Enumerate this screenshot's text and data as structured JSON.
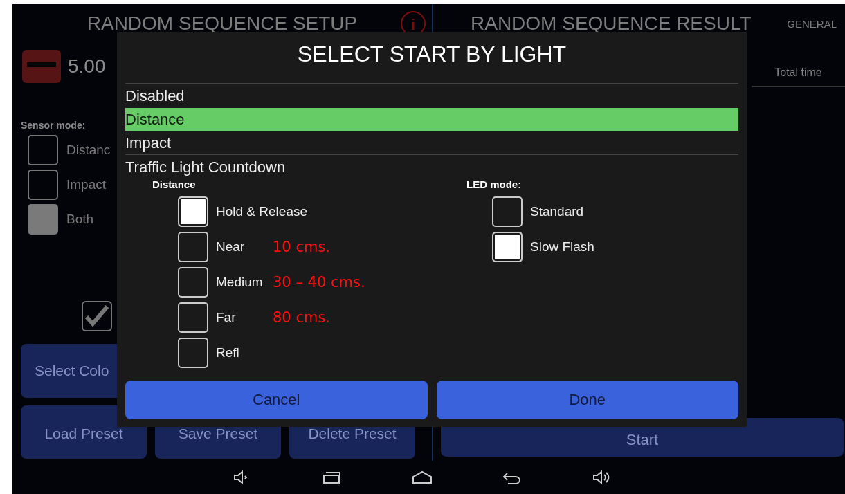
{
  "setup_panel": {
    "title": "RANDOM SEQUENCE SETUP",
    "duration": "5.00",
    "sensor_mode": {
      "label": "Sensor mode:",
      "options": [
        {
          "label": "Distanc",
          "checked": false
        },
        {
          "label": "Impact",
          "checked": false
        },
        {
          "label": "Both",
          "checked": true
        }
      ]
    },
    "enable_checkbox": {
      "checked": true
    },
    "select_color_button": "Select Colo",
    "preset_buttons": [
      "Load Preset",
      "Save Preset",
      "Delete Preset"
    ]
  },
  "result_panel": {
    "title": "RANDOM SEQUENCE RESULT",
    "tab": "GENERAL",
    "column_header": "Total time",
    "start_button": "Start"
  },
  "dialog": {
    "title": "SELECT START BY LIGHT",
    "options": [
      {
        "label": "Disabled",
        "selected": false
      },
      {
        "label": "Distance",
        "selected": true
      },
      {
        "label": "Impact",
        "selected": false
      },
      {
        "label": "Traffic Light Countdown",
        "selected": false
      }
    ],
    "distance": {
      "label": "Distance",
      "options": [
        {
          "label": "Hold & Release",
          "checked": true
        },
        {
          "label": "Near",
          "checked": false,
          "note": "10 cms."
        },
        {
          "label": "Medium",
          "checked": false,
          "note": "30 – 40 cms."
        },
        {
          "label": "Far",
          "checked": false,
          "note": "80 cms."
        },
        {
          "label": "Refl",
          "checked": false
        }
      ]
    },
    "led_mode": {
      "label": "LED mode:",
      "options": [
        {
          "label": "Standard",
          "checked": false
        },
        {
          "label": "Slow Flash",
          "checked": true
        }
      ]
    },
    "buttons": [
      "Cancel",
      "Done"
    ]
  }
}
